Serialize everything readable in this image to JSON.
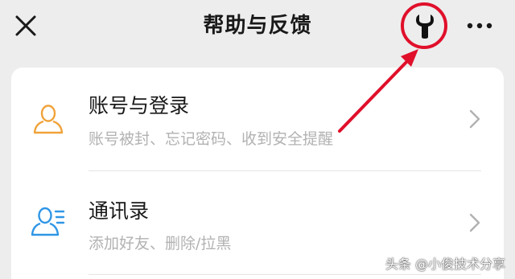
{
  "header": {
    "title": "帮助与反馈",
    "close_icon": "close-icon",
    "wrench_icon": "wrench-icon",
    "more_icon": "more-icon"
  },
  "annotation_color": "#e0102b",
  "accent_orange": "#f0a33a",
  "accent_blue": "#2f96e6",
  "items": [
    {
      "title": "账号与登录",
      "subtitle": "账号被封、忘记密码、收到安全提醒",
      "icon": "person-outline-icon"
    },
    {
      "title": "通讯录",
      "subtitle": "添加好友、删除/拉黑",
      "icon": "contacts-icon"
    }
  ],
  "watermark": "头条 @小俊技术分享"
}
